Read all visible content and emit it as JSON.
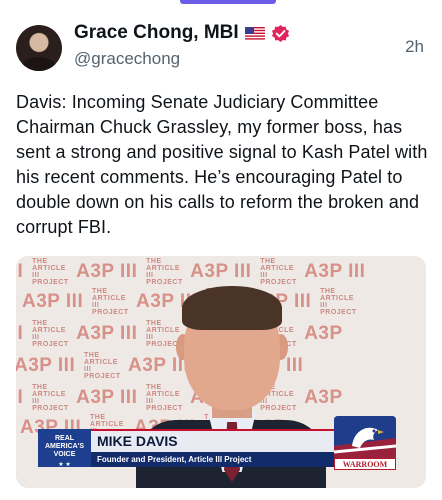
{
  "post": {
    "author_name": "Grace Chong, MBI",
    "handle": "@gracechong",
    "time": "2h",
    "body": "Davis: Incoming Senate Judiciary Committee Chairman Chuck Grassley, my former boss, has sent a strong and positive signal to Kash Patel with his recent comments. He’s encouraging Patel to double down on his calls to reform the broken and corrupt FBI.",
    "icons": {
      "flag": "us-flag-icon",
      "verified": "verified-badge-icon"
    },
    "colors": {
      "verified": "#e0245e",
      "accent": "#6c5ce7"
    }
  },
  "media": {
    "background_logo": "A3P",
    "background_small": "THE ARTICLE III PROJECT",
    "lower_third": {
      "badge": "REAL AMERICA'S VOICE",
      "name": "MIKE DAVIS",
      "title": "Founder and President, Article III Project"
    },
    "network_logo": "WARROOM"
  }
}
